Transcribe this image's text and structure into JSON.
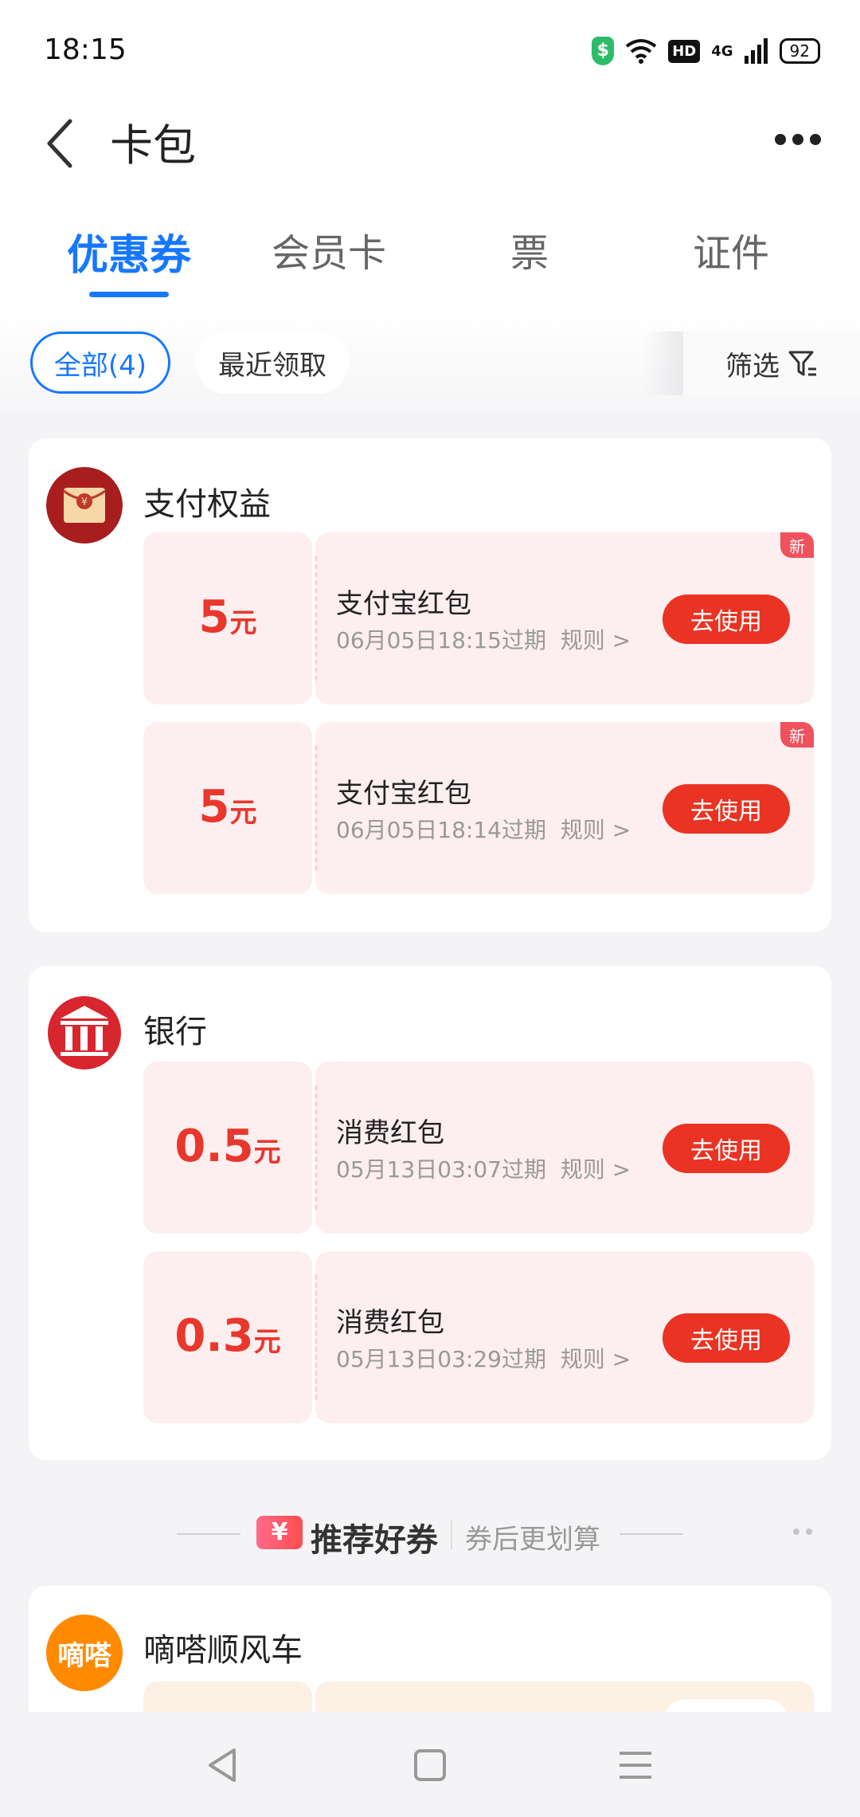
{
  "status_bar": {
    "time": "18:15",
    "hd_label": "HD",
    "network_label": "4G",
    "battery": "92"
  },
  "header": {
    "title": "卡包"
  },
  "tabs": [
    {
      "label": "优惠券",
      "active": true
    },
    {
      "label": "会员卡",
      "active": false
    },
    {
      "label": "票",
      "active": false
    },
    {
      "label": "证件",
      "active": false
    }
  ],
  "filters": {
    "all": "全部(4)",
    "recent": "最近领取",
    "filter": "筛选"
  },
  "groups": [
    {
      "title": "支付权益",
      "coupons": [
        {
          "amount": "5",
          "unit": "元",
          "name": "支付宝红包",
          "expiry": "06月05日18:15过期",
          "rules": "规则",
          "action": "去使用",
          "badge": "新"
        },
        {
          "amount": "5",
          "unit": "元",
          "name": "支付宝红包",
          "expiry": "06月05日18:14过期",
          "rules": "规则",
          "action": "去使用",
          "badge": "新"
        }
      ]
    },
    {
      "title": "银行",
      "coupons": [
        {
          "amount": "0.5",
          "unit": "元",
          "name": "消费红包",
          "expiry": "05月13日03:07过期",
          "rules": "规则",
          "action": "去使用"
        },
        {
          "amount": "0.3",
          "unit": "元",
          "name": "消费红包",
          "expiry": "05月13日03:29过期",
          "rules": "规则",
          "action": "去使用"
        }
      ]
    }
  ],
  "recommend": {
    "icon_text": "¥",
    "title": "推荐好券",
    "subtitle": "券后更划算"
  },
  "partial_group": {
    "logo_text": "嘀嗒",
    "title": "嘀嗒顺风车"
  },
  "colors": {
    "accent": "#1677ff",
    "coupon_red": "#e8372c",
    "button_red": "#ea3323",
    "coupon_bg": "#fdeef0"
  }
}
